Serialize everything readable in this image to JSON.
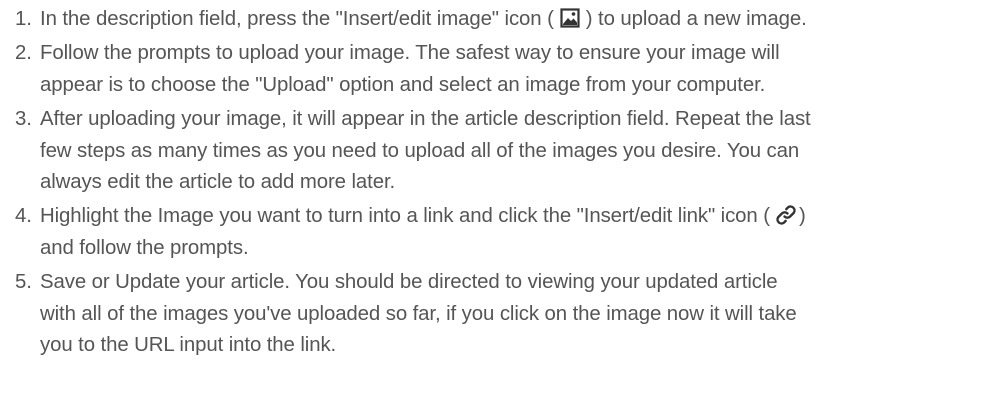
{
  "steps": [
    {
      "number": "1.",
      "before": "In the description field, press the \"Insert/edit image\" icon (",
      "icon": "image-icon",
      "after": ") to upload a new image."
    },
    {
      "number": "2.",
      "line1": "Follow the prompts to upload your image. The safest way to ensure your image will",
      "line2": "appear is to choose the \"Upload\" option and select an image from your computer."
    },
    {
      "number": "3.",
      "line1": "After uploading your image, it will appear in the article description field. Repeat the last",
      "line2": "few steps as many times as you need to upload all of the images you desire. You can",
      "line3": "always edit the article to add more later."
    },
    {
      "number": "4.",
      "before": "Highlight the Image you want to turn into a link and click the \"Insert/edit link\" icon (",
      "icon": "link-icon",
      "after": ")",
      "line2": "and follow the prompts."
    },
    {
      "number": "5.",
      "line1": "Save or Update your article. You should be directed to viewing your updated article",
      "line2": "with all of the images you've uploaded so far, if you click on the image now it will take",
      "line3": "you to the URL input into the link."
    }
  ],
  "colors": {
    "text": "#555555",
    "icon": "#333333"
  }
}
